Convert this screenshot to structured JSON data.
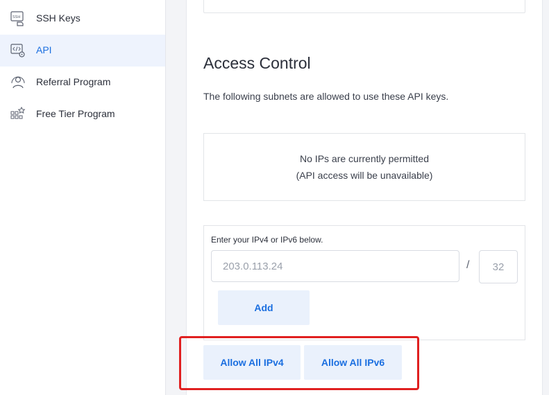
{
  "sidebar": {
    "items": [
      {
        "label": "SSH Keys",
        "icon": "ssh-key-icon",
        "active": false
      },
      {
        "label": "API",
        "icon": "api-icon",
        "active": true
      },
      {
        "label": "Referral Program",
        "icon": "referral-icon",
        "active": false
      },
      {
        "label": "Free Tier Program",
        "icon": "free-tier-icon",
        "active": false
      }
    ],
    "ssh_icon_text": "SSH"
  },
  "access_control": {
    "title": "Access Control",
    "description": "The following subnets are allowed to use these API keys.",
    "empty_line1": "No IPs are currently permitted",
    "empty_line2": "(API access will be unavailable)",
    "form_label": "Enter your IPv4 or IPv6 below.",
    "ip_placeholder": "203.0.113.24",
    "cidr_separator": "/",
    "cidr_placeholder": "32",
    "add_label": "Add",
    "allow_ipv4_label": "Allow All IPv4",
    "allow_ipv6_label": "Allow All IPv6"
  },
  "colors": {
    "accent": "#1b6fe0",
    "active_bg": "#eef3fd",
    "button_bg": "#eaf1fc",
    "highlight": "#e02020"
  }
}
